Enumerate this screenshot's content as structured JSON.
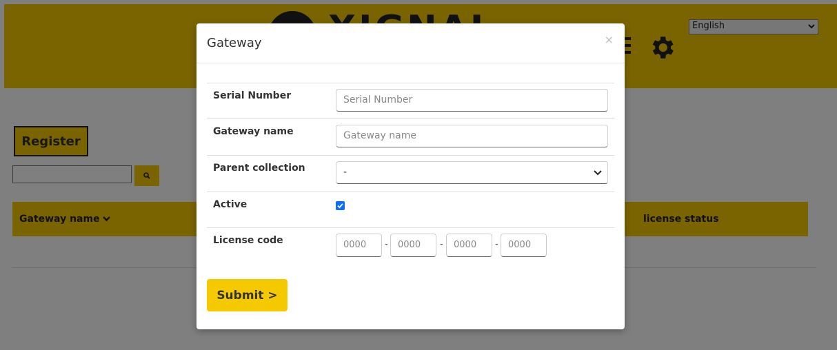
{
  "header": {
    "logo_text": "XIGNAL",
    "language": "English"
  },
  "page": {
    "register_label": "Register",
    "table_headers": {
      "gateway_name": "Gateway name",
      "license_status": "license status"
    }
  },
  "modal": {
    "title": "Gateway",
    "close": "×",
    "fields": {
      "serial_number": {
        "label": "Serial Number",
        "placeholder": "Serial Number"
      },
      "gateway_name": {
        "label": "Gateway name",
        "placeholder": "Gateway name"
      },
      "parent_collection": {
        "label": "Parent collection",
        "value": "-"
      },
      "active": {
        "label": "Active",
        "checked": true
      },
      "license_code": {
        "label": "License code",
        "placeholders": [
          "0000",
          "0000",
          "0000",
          "0000"
        ],
        "separator": "-"
      }
    },
    "submit_label": "Submit >"
  },
  "colors": {
    "brand_yellow": "#f5c900",
    "checkbox_blue": "#0d6efd"
  }
}
